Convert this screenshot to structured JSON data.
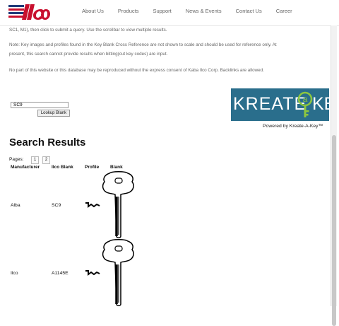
{
  "nav": {
    "links": [
      "About Us",
      "Products",
      "Support",
      "News & Events",
      "Contact Us",
      "Career"
    ]
  },
  "intro": {
    "line1": "SC1, M1), then click to submit a query. Use the scrollbar to view multiple results.",
    "line2": "Note:  Key images and profiles found in the Key Blank Cross Reference are not shown to scale and should be used for reference only. At",
    "line3": "present, this search cannot provide results when bitting(cut key codes) are input.",
    "line4": "No part of this website or this database may be reproduced without the express consent of Kaba Ilco Corp. Backlinks are allowed."
  },
  "search": {
    "value": "SC9",
    "button_label": "Lookup Blank"
  },
  "banner": {
    "part1": "KREATE",
    "part2": "KEY",
    "powered_by": "Powered by Kreate-A-Key™"
  },
  "results": {
    "title": "Search Results",
    "pages_label": "Pages:",
    "pages": [
      "1",
      "2"
    ],
    "columns": [
      "Manufacturer",
      "Ilco Blank",
      "Profile",
      "Blank"
    ],
    "rows": [
      {
        "manufacturer": "Alba",
        "ilco_blank": "SC9"
      },
      {
        "manufacturer": "Ilco",
        "ilco_blank": "A1145E"
      }
    ]
  },
  "colors": {
    "banner_bg": "#2a6e8c",
    "banner_accent": "#8dc63f",
    "logo_red": "#c8102e",
    "logo_blue": "#1f3b7a"
  }
}
